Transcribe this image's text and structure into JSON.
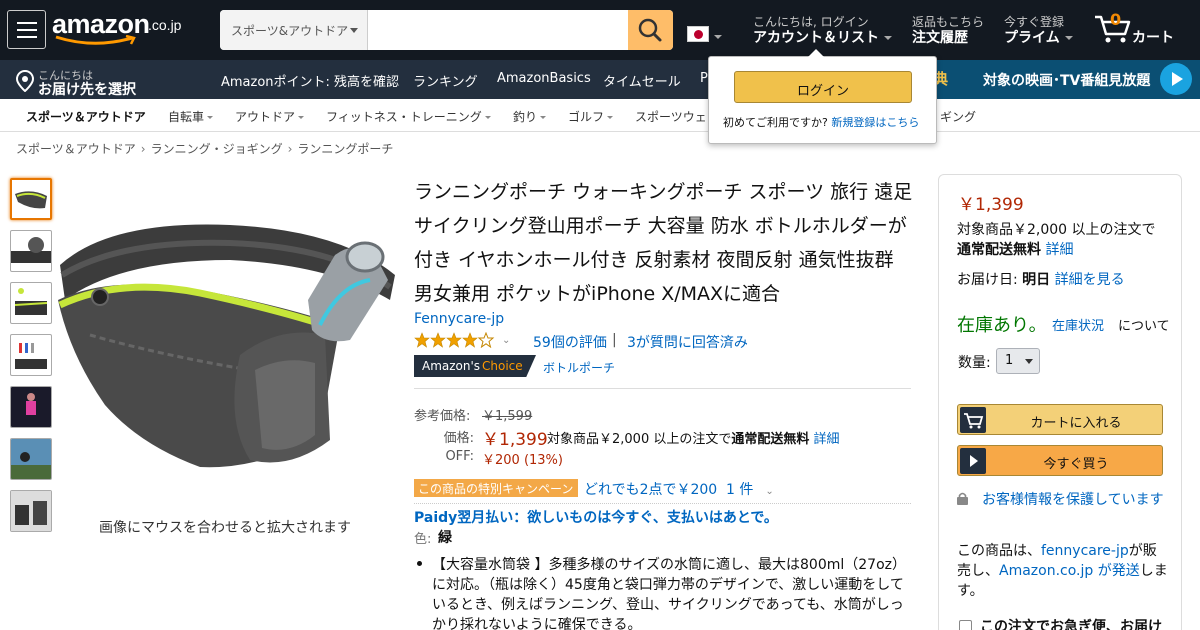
{
  "header": {
    "logo_text": "amazon",
    "logo_tld": ".co.jp",
    "search_category": "スポーツ&アウトドア",
    "search_placeholder": "",
    "account_line1": "こんにちは, ログイン",
    "account_line2": "アカウント＆リスト",
    "orders_line1": "返品もこちら",
    "orders_line2": "注文履歴",
    "prime_line1": "今すぐ登録",
    "prime_line2": "プライム",
    "cart_count": "0",
    "cart_label": "カート"
  },
  "subnav": {
    "deliver_line1": "こんにちは",
    "deliver_line2": "お届け先を選択",
    "items": [
      "Amazonポイント: 残高を確認",
      "ランキング",
      "AmazonBasics",
      "タイムセール",
      "P"
    ],
    "promo_token": "特典",
    "promo_text": "対象の映画･TV番組見放題"
  },
  "category_bar": {
    "items": [
      "スポーツ＆アウトドア",
      "自転車",
      "アウトドア",
      "フィットネス・トレーニング",
      "釣り",
      "ゴルフ",
      "スポーツウェ",
      "ギング"
    ]
  },
  "breadcrumb": [
    "スポーツ＆アウトドア",
    "ランニング・ジョギング",
    "ランニングポーチ"
  ],
  "image_caption": "画像にマウスを合わせると拡大されます",
  "product": {
    "title": "ランニングポーチ ウォーキングポーチ スポーツ 旅行 遠足 サイクリング登山用ポーチ 大容量 防水 ボトルホルダーが付き イヤホンホール付き 反射素材 夜間反射 通気性抜群 男女兼用 ポケットがiPhone X/MAXに適合",
    "brand": "Fennycare-jp",
    "rating": 4.0,
    "reviews": "59個の評価",
    "questions": "3が質問に回答済み",
    "choice_a": "Amazon's",
    "choice_b": "Choice",
    "choice_category": "ボトルポーチ",
    "list_price_label": "参考価格:",
    "list_price": "￥1,599",
    "price_label": "価格:",
    "price": "￥1,399",
    "price_note_prefix": "対象商品￥2,000 以上の注文で",
    "price_note_bold": "通常配送無料",
    "price_note_link": "詳細",
    "off_label": "OFF:",
    "off_value": "￥200 (13%)",
    "campaign_badge": "この商品の特別キャンペーン",
    "campaign_link": "どれでも2点で￥200",
    "campaign_count": "1 件",
    "paidy": "Paidy翌月払い：欲しいものは今すぐ、支払いはあとで。",
    "color_label": "色:",
    "color_value": "緑",
    "bullet1": "【大容量水筒袋 】多種多様のサイズの水筒に適し、最大は800ml（27oz）に対応。（瓶は除く）45度角と袋口弾力帯のデザインで、激しい運動をしているとき、例えばランニング、登山、サイクリングであっても、水筒がしっかり採れないように確保できる。"
  },
  "buybox": {
    "price": "￥1,399",
    "shipping_line1": "対象商品￥2,000 以上の注文で",
    "shipping_bold": "通常配送無料",
    "shipping_link": "詳細",
    "delivery_prefix": "お届け日:",
    "delivery_bold": "明日",
    "delivery_link": "詳細を見る",
    "stock": "在庫あり。",
    "stock_link": "在庫状況",
    "stock_tail": "について",
    "qty_label": "数量:",
    "qty_value": "1",
    "add_to_cart": "カートに入れる",
    "buy_now": "今すぐ買う",
    "secure": "お客様情報を保護しています",
    "seller_prefix": "この商品は、",
    "seller_name": "fennycare-jp",
    "seller_mid": "が販売し、",
    "seller_ship": "Amazon.co.jp が発送",
    "seller_tail": "します。",
    "fast_text": "この注文でお急ぎ便、お届け"
  },
  "popover": {
    "login_button": "ログイン",
    "first_time": "初めてご利用ですか?",
    "register_link": "新規登録はこちら"
  },
  "colors": {
    "nav_bg": "#131921",
    "subnav_bg": "#232f3e",
    "search_button": "#febd69",
    "price": "#b12704",
    "link": "#0066c0",
    "stock": "#007600",
    "cart_button": "#f3d078",
    "buy_button": "#f7a847"
  }
}
